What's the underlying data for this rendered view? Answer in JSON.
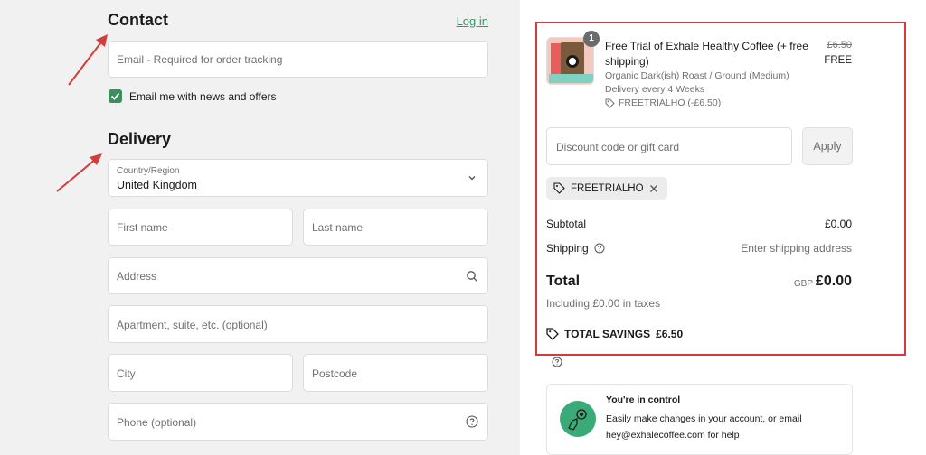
{
  "contact": {
    "heading": "Contact",
    "login_label": "Log in",
    "email_placeholder": "Email - Required for order tracking",
    "newsletter_label": "Email me with news and offers",
    "newsletter_checked": true
  },
  "delivery": {
    "heading": "Delivery",
    "country_label": "Country/Region",
    "country_value": "United Kingdom",
    "first_name_placeholder": "First name",
    "last_name_placeholder": "Last name",
    "address_placeholder": "Address",
    "apartment_placeholder": "Apartment, suite, etc. (optional)",
    "city_placeholder": "City",
    "postcode_placeholder": "Postcode",
    "phone_placeholder": "Phone (optional)"
  },
  "summary": {
    "product": {
      "quantity": "1",
      "title": "Free Trial of Exhale Healthy Coffee (+ free shipping)",
      "variant": "Organic Dark(ish) Roast / Ground (Medium)",
      "frequency": "Delivery every 4 Weeks",
      "discount_tag": "FREETRIALHO (-£6.50)",
      "original_price": "£6.50",
      "price": "FREE"
    },
    "discount_placeholder": "Discount code or gift card",
    "apply_label": "Apply",
    "applied_code": "FREETRIALHO",
    "subtotal_label": "Subtotal",
    "subtotal_value": "£0.00",
    "shipping_label": "Shipping",
    "shipping_value": "Enter shipping address",
    "total_label": "Total",
    "currency": "GBP",
    "total_value": "£0.00",
    "tax_note": "Including £0.00 in taxes",
    "savings_label": "TOTAL SAVINGS",
    "savings_value": "£6.50"
  },
  "control_card": {
    "title": "You're in control",
    "line1": "Easily make changes in your account, or email",
    "line2": "hey@exhalecoffee.com for help"
  },
  "colors": {
    "accent_green": "#2c9b6a",
    "annotation_red": "#d43b3b",
    "left_panel_bg": "#f0f1f0"
  }
}
